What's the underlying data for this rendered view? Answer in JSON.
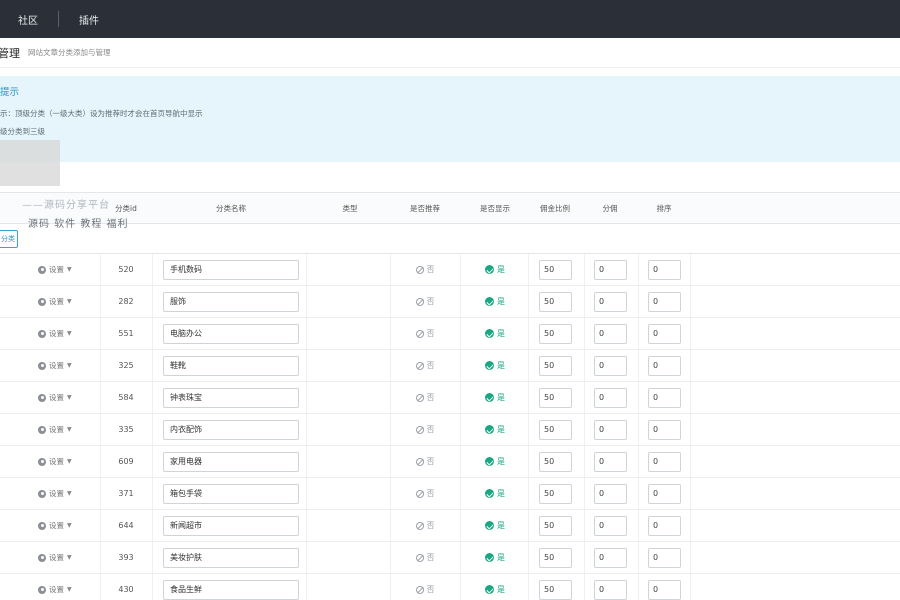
{
  "topnav": {
    "items": [
      "社区",
      "插件"
    ]
  },
  "header": {
    "title": "管理",
    "subtitle": "网站文章分类添加与管理"
  },
  "tips": {
    "title": "提示",
    "line1": "示：顶级分类（一级大类）设为推荐时才会在首页导航中显示",
    "line2": "级分类到三级"
  },
  "watermark": {
    "line1": "——源码分享平台",
    "line2": "源码 软件 教程 福利"
  },
  "table": {
    "columns": {
      "id": "分类id",
      "name": "分类名称",
      "type": "类型",
      "recommend": "是否推荐",
      "show": "是否显示",
      "commission": "佣金比例",
      "share": "分佣",
      "sort": "排序"
    },
    "add_label": "分类",
    "op_label": "设置",
    "recommend_label": "否",
    "show_label": "是",
    "rows": [
      {
        "id": "520",
        "name": "手机数码",
        "commission": "50",
        "share": "0",
        "sort": "0"
      },
      {
        "id": "282",
        "name": "服饰",
        "commission": "50",
        "share": "0",
        "sort": "0"
      },
      {
        "id": "551",
        "name": "电脑办公",
        "commission": "50",
        "share": "0",
        "sort": "0"
      },
      {
        "id": "325",
        "name": "鞋靴",
        "commission": "50",
        "share": "0",
        "sort": "0"
      },
      {
        "id": "584",
        "name": "钟表珠宝",
        "commission": "50",
        "share": "0",
        "sort": "0"
      },
      {
        "id": "335",
        "name": "内衣配饰",
        "commission": "50",
        "share": "0",
        "sort": "0"
      },
      {
        "id": "609",
        "name": "家用电器",
        "commission": "50",
        "share": "0",
        "sort": "0"
      },
      {
        "id": "371",
        "name": "箱包手袋",
        "commission": "50",
        "share": "0",
        "sort": "0"
      },
      {
        "id": "644",
        "name": "新闻超市",
        "commission": "50",
        "share": "0",
        "sort": "0"
      },
      {
        "id": "393",
        "name": "美妆护肤",
        "commission": "50",
        "share": "0",
        "sort": "0"
      },
      {
        "id": "430",
        "name": "食品生鲜",
        "commission": "50",
        "share": "0",
        "sort": "0"
      }
    ]
  }
}
